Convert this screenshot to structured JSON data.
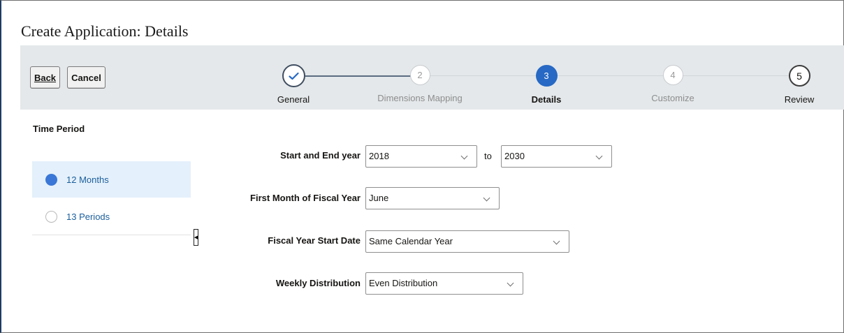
{
  "page": {
    "title": "Create Application: Details"
  },
  "toolbar": {
    "back_label": "Back",
    "cancel_label": "Cancel"
  },
  "train": {
    "steps": [
      {
        "number": "",
        "icon": "checkmark-icon",
        "label": "General",
        "state": "completed"
      },
      {
        "number": "2",
        "label": "Dimensions Mapping",
        "state": "disabled"
      },
      {
        "number": "3",
        "label": "Details",
        "state": "current"
      },
      {
        "number": "4",
        "label": "Customize",
        "state": "disabled"
      },
      {
        "number": "5",
        "label": "Review",
        "state": "enabled"
      }
    ]
  },
  "sidebar": {
    "title": "Time Period",
    "options": [
      {
        "label": "12 Months",
        "selected": true
      },
      {
        "label": "13 Periods",
        "selected": false
      }
    ]
  },
  "form": {
    "start_end_year": {
      "label": "Start and End year",
      "start": "2018",
      "connector": "to",
      "end": "2030"
    },
    "first_month": {
      "label": "First Month of Fiscal Year",
      "value": "June"
    },
    "fiscal_start": {
      "label": "Fiscal Year Start Date",
      "value": "Same Calendar Year"
    },
    "weekly_distribution": {
      "label": "Weekly Distribution",
      "value": "Even Distribution"
    }
  },
  "colors": {
    "accent": "#2769c4",
    "train_bg": "#e4e8ea",
    "selected_bg": "#e4f0fb",
    "link": "#1b5e9c"
  }
}
